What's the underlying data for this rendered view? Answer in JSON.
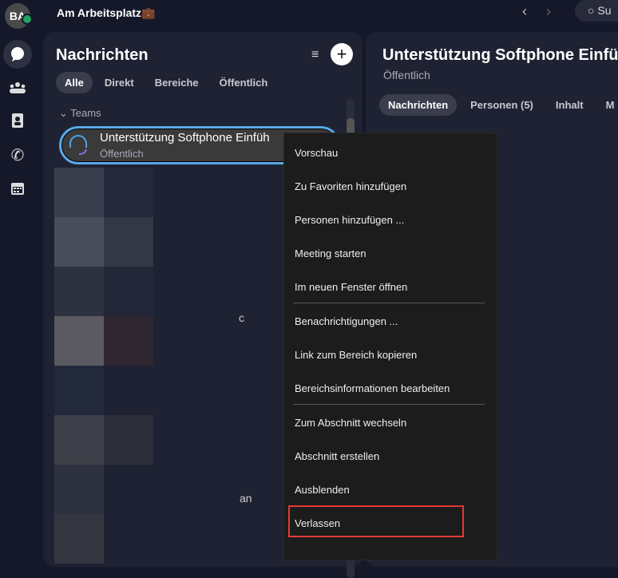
{
  "header": {
    "avatar_initials": "BA",
    "status": "Am Arbeitsplatz",
    "status_emoji": "💼",
    "search_label": "Su"
  },
  "rail": {
    "items": [
      "chat",
      "teams",
      "contacts",
      "calls",
      "calendar"
    ]
  },
  "list": {
    "title": "Nachrichten",
    "tabs": [
      "Alle",
      "Direkt",
      "Bereiche",
      "Öffentlich"
    ],
    "section": "Teams",
    "selected": {
      "name": "Unterstützung Softphone Einführung",
      "visible_name": "Unterstützung Softphone Einfüh",
      "subtitle": "Öffentlich"
    },
    "partial_texts": [
      "c",
      "an"
    ]
  },
  "detail": {
    "title": "Unterstützung Softphone Einfüh",
    "subtitle": "Öffentlich",
    "tabs": [
      "Nachrichten",
      "Personen (5)",
      "Inhalt",
      "M"
    ]
  },
  "menu": {
    "items": [
      "Vorschau",
      "Zu Favoriten hinzufügen",
      "Personen hinzufügen ...",
      "Meeting starten",
      "Im neuen Fenster öffnen",
      "Benachrichtigungen ...",
      "Link zum Bereich kopieren",
      "Bereichsinformationen bearbeiten",
      "Zum Abschnitt wechseln",
      "Abschnitt erstellen",
      "Ausblenden",
      "Verlassen"
    ],
    "highlighted": "Verlassen",
    "highlight_color": "#e53935"
  }
}
